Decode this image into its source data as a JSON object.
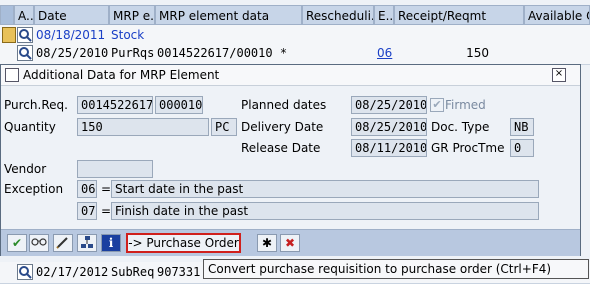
{
  "grid": {
    "columns": [
      "A..",
      "Date",
      "MRP e...",
      "MRP element data",
      "Rescheduli...",
      "E...",
      "Receipt/Reqmt",
      "Available Q..."
    ],
    "rows": [
      {
        "date": "08/18/2011",
        "mrp_element": "Stock",
        "data": "",
        "resched": "",
        "e": "",
        "receipt": ""
      },
      {
        "date": "08/25/2010",
        "mrp_element": "PurRqs",
        "data": "0014522617/00010 *",
        "resched": "",
        "e": "06",
        "receipt": "150"
      },
      {
        "date": "02/17/2012",
        "mrp_element": "SubReq",
        "data": "907331",
        "resched": "",
        "e": "",
        "receipt": ""
      }
    ]
  },
  "dialog": {
    "title": "Additional Data for MRP Element",
    "purch_req_label": "Purch.Req.",
    "purch_req_no": "0014522617",
    "purch_req_item": "000010",
    "quantity_label": "Quantity",
    "quantity_value": "150",
    "quantity_unit": "PC",
    "vendor_label": "Vendor",
    "vendor_value": "",
    "exception_label": "Exception",
    "exceptions": [
      {
        "code": "06",
        "eq": "=",
        "text": "Start date in the past"
      },
      {
        "code": "07",
        "eq": "=",
        "text": "Finish date in the past"
      }
    ],
    "planned_dates_label": "Planned dates",
    "planned_dates_value": "08/25/2010",
    "firmed_label": "Firmed",
    "delivery_date_label": "Delivery Date",
    "delivery_date_value": "08/25/2010",
    "doc_type_label": "Doc. Type",
    "doc_type_value": "NB",
    "release_date_label": "Release Date",
    "release_date_value": "08/11/2010",
    "gr_proc_label": "GR ProcTme",
    "gr_proc_value": "0",
    "po_button_label": "-> Purchase Order"
  },
  "tooltip": "Convert purchase requisition to purchase order   (Ctrl+F4)",
  "colors": {
    "link": "#1a3fc6",
    "check": "#2a8a2a",
    "cancel": "#c62020",
    "po_border": "#d0201c"
  }
}
